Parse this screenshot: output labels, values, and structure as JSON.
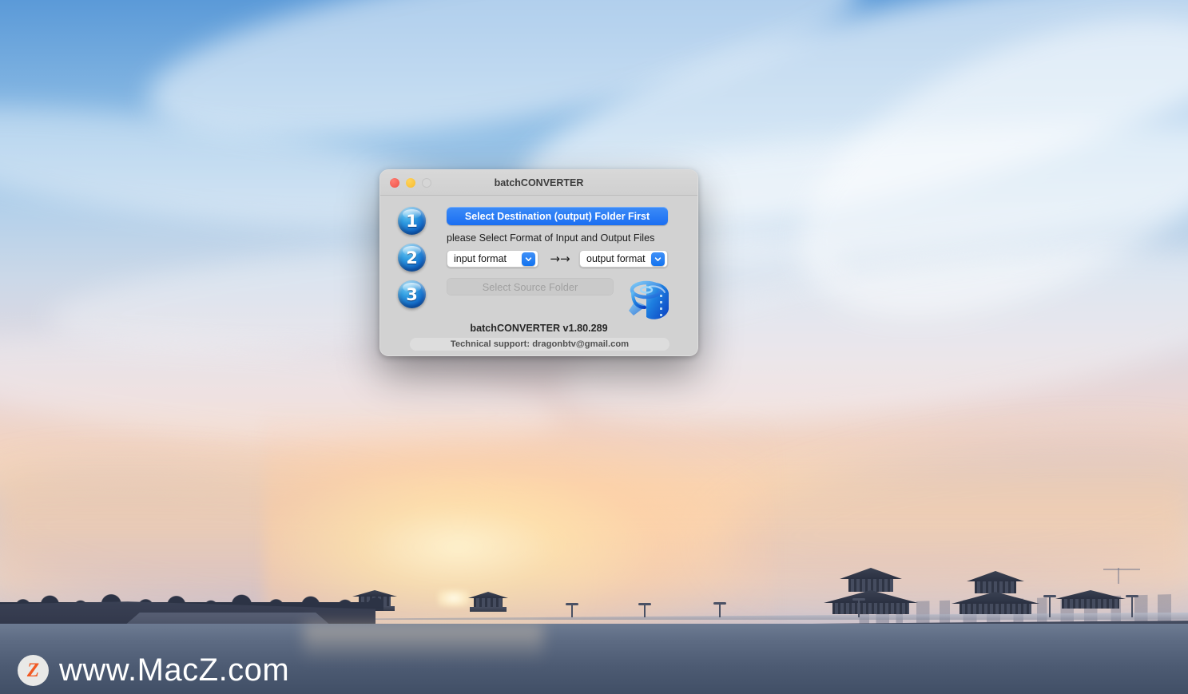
{
  "desktop": {
    "watermark": {
      "badge_letter": "Z",
      "text": "www.MacZ.com",
      "badge_color": "#f15a24"
    }
  },
  "window": {
    "title": "batchCONVERTER",
    "traffic_lights": [
      {
        "name": "close",
        "color": "#ef5349",
        "enabled": true
      },
      {
        "name": "minimize",
        "color": "#f7bc2e",
        "enabled": true
      },
      {
        "name": "zoom",
        "color": "#d6d6d6",
        "enabled": false
      }
    ],
    "steps": [
      {
        "number": "1"
      },
      {
        "number": "2"
      },
      {
        "number": "3"
      }
    ],
    "step1": {
      "button_label": "Select Destination (output) Folder First",
      "accent": "#1a6ef2"
    },
    "step2": {
      "instruction": "please Select Format of Input and Output Files",
      "input_format": {
        "value": "input format",
        "icon": "chevron-down-icon"
      },
      "arrows": "→→",
      "output_format": {
        "value": "output format",
        "icon": "chevron-down-icon"
      }
    },
    "step3": {
      "button_label": "Select Source Folder",
      "enabled": false
    },
    "app_icon": "film-roll-icon",
    "footer": {
      "version": "batchCONVERTER v1.80.289",
      "support": "Technical support: dragonbtv@gmail.com"
    }
  }
}
